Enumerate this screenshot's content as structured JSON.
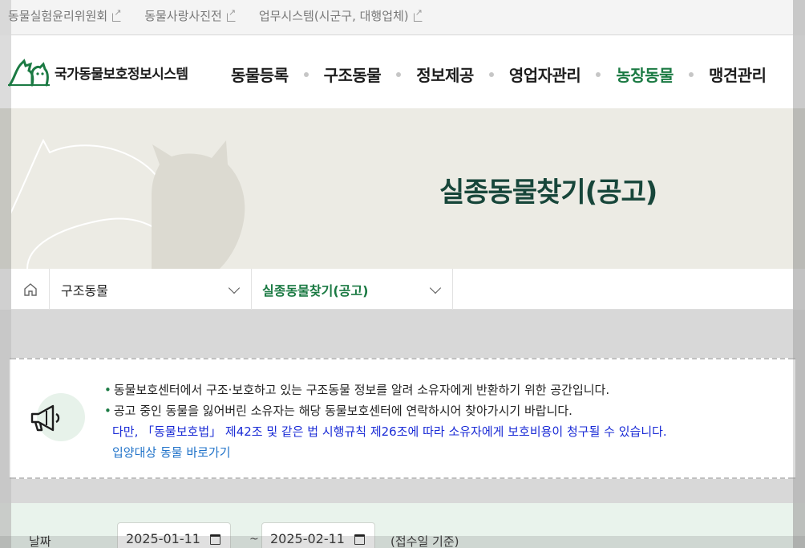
{
  "util_links": [
    {
      "label": "동물실험윤리위원회"
    },
    {
      "label": "동물사랑사진전"
    },
    {
      "label": "업무시스템(시군구, 대행업체)"
    }
  ],
  "logo": {
    "text": "국가동물보호정보시스템"
  },
  "gnb": [
    {
      "label": "동물등록"
    },
    {
      "label": "구조동물"
    },
    {
      "label": "정보제공"
    },
    {
      "label": "영업자관리"
    },
    {
      "label": "농장동물"
    },
    {
      "label": "맹견관리"
    }
  ],
  "banner": {
    "title": "실종동물찾기(공고)"
  },
  "breadcrumb": {
    "level1": "구조동물",
    "level2": "실종동물찾기(공고)"
  },
  "notice": {
    "line1": "동물보호센터에서 구조·보호하고 있는 구조동물 정보를 알려 소유자에게 반환하기 위한 공간입니다.",
    "line2": "공고 중인 동물을 잃어버린 소유자는 해당 동물보호센터에 연락하시어 찾아가시기 바랍니다.",
    "line3": "다만, 「동물보호법」 제42조 및 같은 법 시행규칙 제26조에 따라 소유자에게 보호비용이 청구될 수 있습니다.",
    "link": "입양대상 동물 바로가기"
  },
  "search": {
    "date_label": "날짜",
    "date_from": "2025-01-11",
    "date_to": "2025-02-11",
    "tilde": "~",
    "basis": "(접수일 기준)"
  },
  "colors": {
    "accent": "#1b7a43",
    "banner_title": "#17463a",
    "notice_blue": "#1a2bd6",
    "link_blue": "#2173c9"
  }
}
